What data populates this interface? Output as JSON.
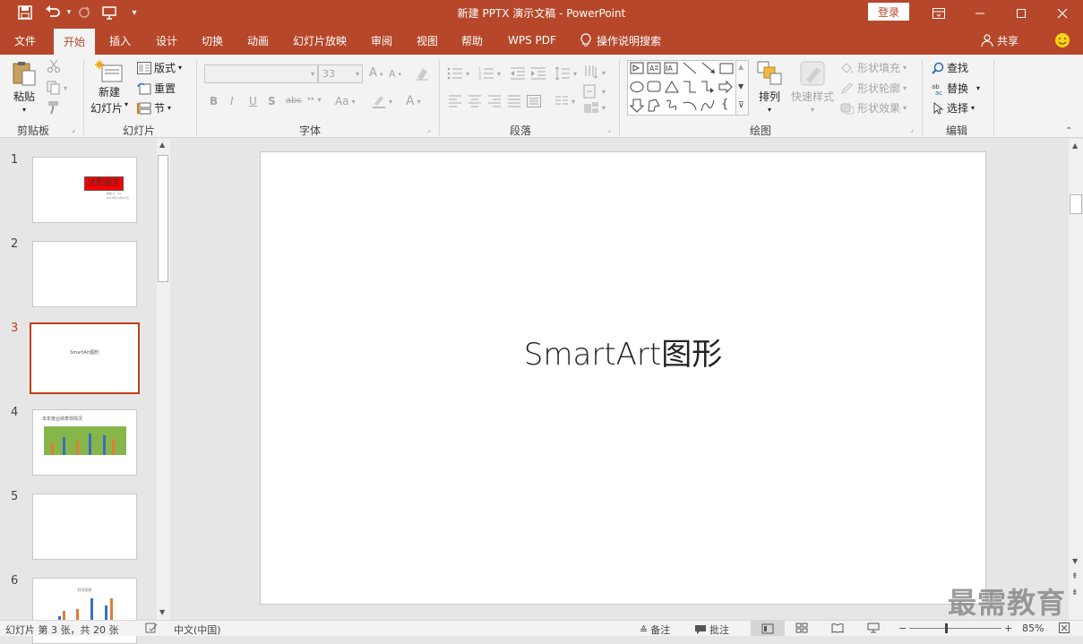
{
  "window": {
    "title": "新建 PPTX 演示文稿 - PowerPoint",
    "login_label": "登录",
    "controls": {
      "ribbon_display": "ribbon-display-icon",
      "minimize": "minimize-icon",
      "maximize": "maximize-icon",
      "close": "close-icon"
    }
  },
  "quick_access": {
    "save": "save-icon",
    "undo": "undo-icon",
    "redo": "redo-icon",
    "from_start": "slideshow-from-start-icon",
    "customize": "customize-qat-icon"
  },
  "tabs": [
    {
      "label": "文件"
    },
    {
      "label": "开始",
      "active": true
    },
    {
      "label": "插入"
    },
    {
      "label": "设计"
    },
    {
      "label": "切换"
    },
    {
      "label": "动画"
    },
    {
      "label": "幻灯片放映"
    },
    {
      "label": "审阅"
    },
    {
      "label": "视图"
    },
    {
      "label": "帮助"
    },
    {
      "label": "WPS PDF"
    }
  ],
  "tell_me": "操作说明搜索",
  "share": "共享",
  "ribbon": {
    "clipboard": {
      "label": "剪贴板",
      "paste": "粘贴"
    },
    "slides": {
      "label": "幻灯片",
      "new_slide_line1": "新建",
      "new_slide_line2": "幻灯片",
      "layout": "版式",
      "reset": "重置",
      "section": "节"
    },
    "font": {
      "label": "字体",
      "font_name": "",
      "font_size": "33",
      "bold": "B",
      "italic": "I",
      "underline": "U",
      "shadow": "S",
      "strike": "abc",
      "case": "Aa"
    },
    "paragraph": {
      "label": "段落"
    },
    "drawing": {
      "label": "绘图",
      "arrange": "排列",
      "quick_styles": "快速样式",
      "shape_fill": "形状填充",
      "shape_outline": "形状轮廓",
      "shape_effects": "形状效果"
    },
    "editing": {
      "label": "编辑",
      "find": "查找",
      "replace": "替换",
      "select": "选择"
    }
  },
  "thumbnails": [
    {
      "num": "1",
      "title": "述职报告",
      "sub1": "述职人：XX",
      "sub2": "2019年XX月XX日"
    },
    {
      "num": "2"
    },
    {
      "num": "3",
      "text": "SmartArt图形",
      "selected": true
    },
    {
      "num": "4",
      "title": "本年度业绩表现情况"
    },
    {
      "num": "5"
    },
    {
      "num": "6",
      "title": "柱形图表"
    }
  ],
  "slide": {
    "text": "SmartArt图形"
  },
  "status": {
    "slide_info": "幻灯片 第 3 张，共 20 张",
    "language": "中文(中国)",
    "notes": "备注",
    "comments": "批注",
    "zoom": "85%"
  },
  "watermark": "最需教育",
  "colors": {
    "accent": "#b7472a",
    "selection": "#c43e1c"
  }
}
